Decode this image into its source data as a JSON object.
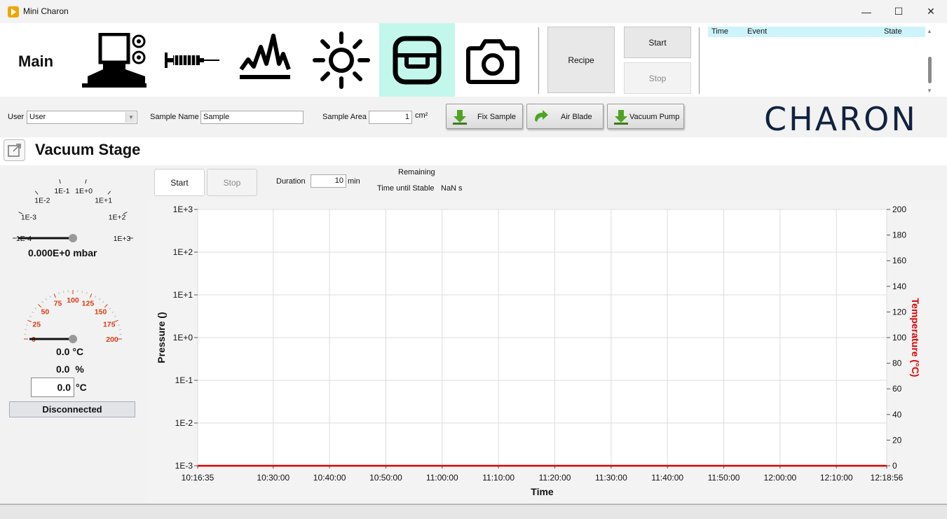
{
  "window": {
    "title": "Mini Charon",
    "minimize_glyph": "—",
    "maximize_glyph": "☐",
    "close_glyph": "✕"
  },
  "toolbar": {
    "main_label": "Main",
    "tools": [
      {
        "name": "instrument-icon",
        "active": false
      },
      {
        "name": "syringe-icon",
        "active": false
      },
      {
        "name": "spectrum-icon",
        "active": false
      },
      {
        "name": "light-icon",
        "active": false
      },
      {
        "name": "vacuum-stage-icon",
        "active": true
      },
      {
        "name": "camera-icon",
        "active": false
      }
    ],
    "recipe_label": "Recipe",
    "start_label": "Start",
    "stop_label": "Stop"
  },
  "event_log": {
    "columns": [
      "Time",
      "Event",
      "State"
    ],
    "rows": []
  },
  "settings": {
    "user_label": "User",
    "user_value": "User",
    "sample_name_label": "Sample Name",
    "sample_name_value": "Sample",
    "sample_area_label": "Sample Area",
    "sample_area_value": "1",
    "sample_area_unit": "cm²",
    "fix_sample_label": "Fix Sample",
    "air_blade_label": "Air Blade",
    "vacuum_pump_label": "Vacuum Pump"
  },
  "brand": {
    "logo_text": "CHARON",
    "color": "#10223f",
    "active_tool_color": "#c3f7ec"
  },
  "panel": {
    "title": "Vacuum Stage"
  },
  "pressure_gauge": {
    "ticks": [
      "1E-4",
      "1E-3",
      "1E-2",
      "1E-1",
      "1E+0",
      "1E+1",
      "1E+2",
      "1E+3"
    ],
    "value": "0.000E+0",
    "unit": "mbar",
    "needle_fraction": 0
  },
  "temperature_gauge": {
    "ticks": [
      "0",
      "25",
      "50",
      "75",
      "100",
      "125",
      "150",
      "175",
      "200"
    ],
    "value": "0.0",
    "unit": "°C",
    "needle_fraction": 0,
    "tick_color": "#d93a12"
  },
  "humidity": {
    "value": "0.0",
    "unit": "%"
  },
  "setpoint": {
    "value": "0.0",
    "unit": "°C"
  },
  "connection_status": "Disconnected",
  "run_controls": {
    "start_label": "Start",
    "stop_label": "Stop",
    "duration_label": "Duration",
    "duration_value": "10",
    "duration_unit": "min",
    "remaining_label": "Remaining",
    "stable_label": "Time until Stable",
    "stable_value": "NaN s"
  },
  "chart_data": {
    "type": "line",
    "xlabel": "Time",
    "ylabel": "Pressure ()",
    "y2label": "Temperature (°C)",
    "y2color": "#e00000",
    "x_ticks": [
      "10:16:35",
      "10:30:00",
      "10:40:00",
      "10:50:00",
      "11:00:00",
      "11:10:00",
      "11:20:00",
      "11:30:00",
      "11:40:00",
      "11:50:00",
      "12:00:00",
      "12:10:00",
      "12:18:56"
    ],
    "xlim": [
      "10:16:35",
      "12:18:56"
    ],
    "y_ticks": [
      "1E-3",
      "1E-2",
      "1E-1",
      "1E+0",
      "1E+1",
      "1E+2",
      "1E+3"
    ],
    "ylim": [
      0.001,
      1000
    ],
    "y_scale": "log",
    "y2_ticks": [
      "0",
      "20",
      "40",
      "60",
      "80",
      "100",
      "120",
      "140",
      "160",
      "180",
      "200"
    ],
    "y2lim": [
      0,
      200
    ],
    "grid": true,
    "series": [
      {
        "name": "",
        "axis": "y2",
        "color": "#e00000",
        "x": [
          "10:16:35",
          "12:18:56"
        ],
        "values": [
          0,
          0
        ]
      }
    ]
  }
}
